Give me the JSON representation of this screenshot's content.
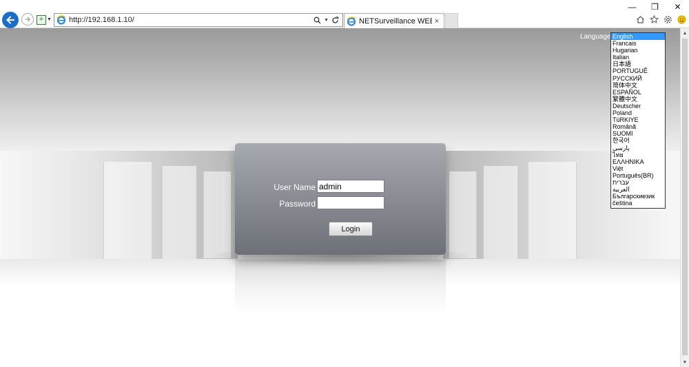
{
  "browser": {
    "address": "http://192.168.1.10/",
    "tab_title": "NETSurveillance WEB",
    "tab_close": "×",
    "window_buttons": {
      "minimize": "—",
      "restore": "❐",
      "close": "✕"
    }
  },
  "login": {
    "username_label": "User Name",
    "username_value": "admin",
    "password_label": "Password",
    "password_value": "",
    "login_button": "Login"
  },
  "language": {
    "label": "Language:",
    "selected": "English",
    "options": [
      "English",
      "Francais",
      "Hugarian",
      "Italian",
      "日本語",
      "PORTUGUÊ",
      "РУССКИЙ",
      "简体中文",
      "ESPAÑOL",
      "繁體中文",
      "Deutscher",
      "Poland",
      "TüRKIYE",
      "Română",
      "SUOMI",
      "한국어",
      "پارسی",
      "ไทย",
      "ΕΛΛΗΝΙΚΑ",
      "Việt",
      "Português(BR)",
      "עברית",
      "العربية",
      "Българскиезик",
      "čeština"
    ]
  },
  "colors": {
    "accent": "#1b6fc9",
    "selection": "#3399ff"
  }
}
